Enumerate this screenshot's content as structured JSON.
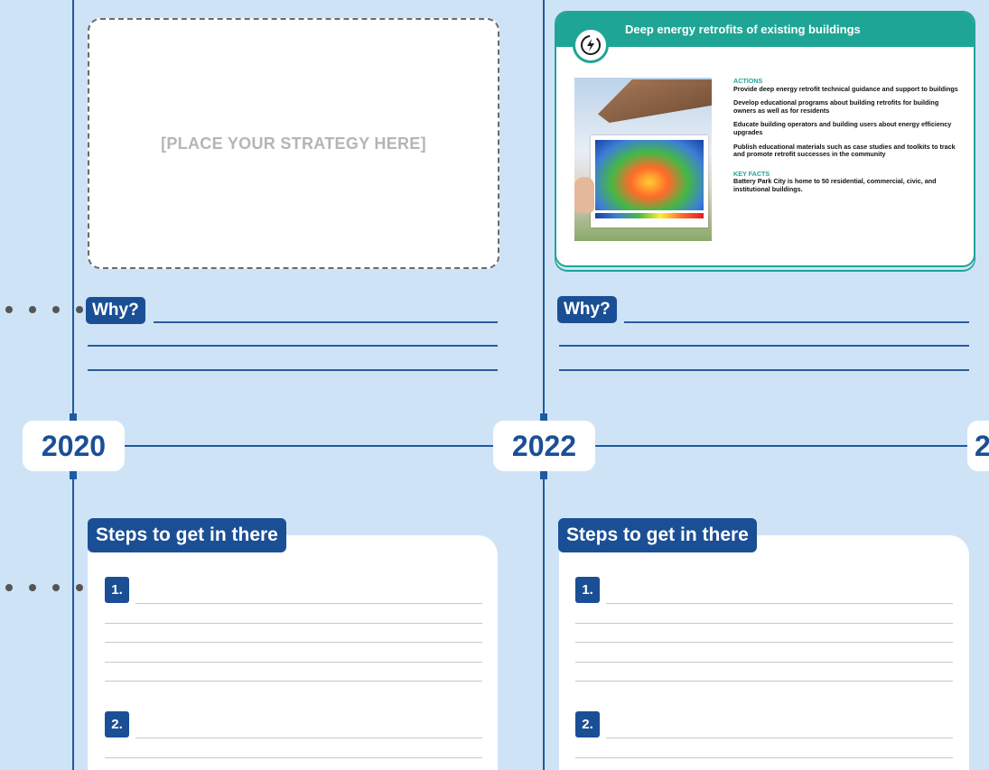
{
  "placeholder_text": "[PLACE YOUR STRATEGY HERE]",
  "years": [
    "2020",
    "2022",
    "2"
  ],
  "why_label": "Why?",
  "steps_label": "Steps to get in there",
  "step_numbers": [
    "1.",
    "2."
  ],
  "card": {
    "title": "Deep energy retrofits of existing buildings",
    "actions_label": "ACTIONS",
    "actions": [
      "Provide deep energy retrofit technical guidance and support to buildings",
      "Develop educational programs about building retrofits for building owners as well as for residents",
      "Educate building operators and building users about energy efficiency upgrades",
      "Publish educational materials such as case studies and toolkits to track and promote retrofit successes in the community"
    ],
    "key_facts_label": "KEY FACTS",
    "key_facts": "Battery Park City is home to 50 residential, commercial, civic, and institutional buildings."
  },
  "colors": {
    "background": "#cfe3f6",
    "navy": "#1b4f95",
    "teal": "#1fa596"
  }
}
